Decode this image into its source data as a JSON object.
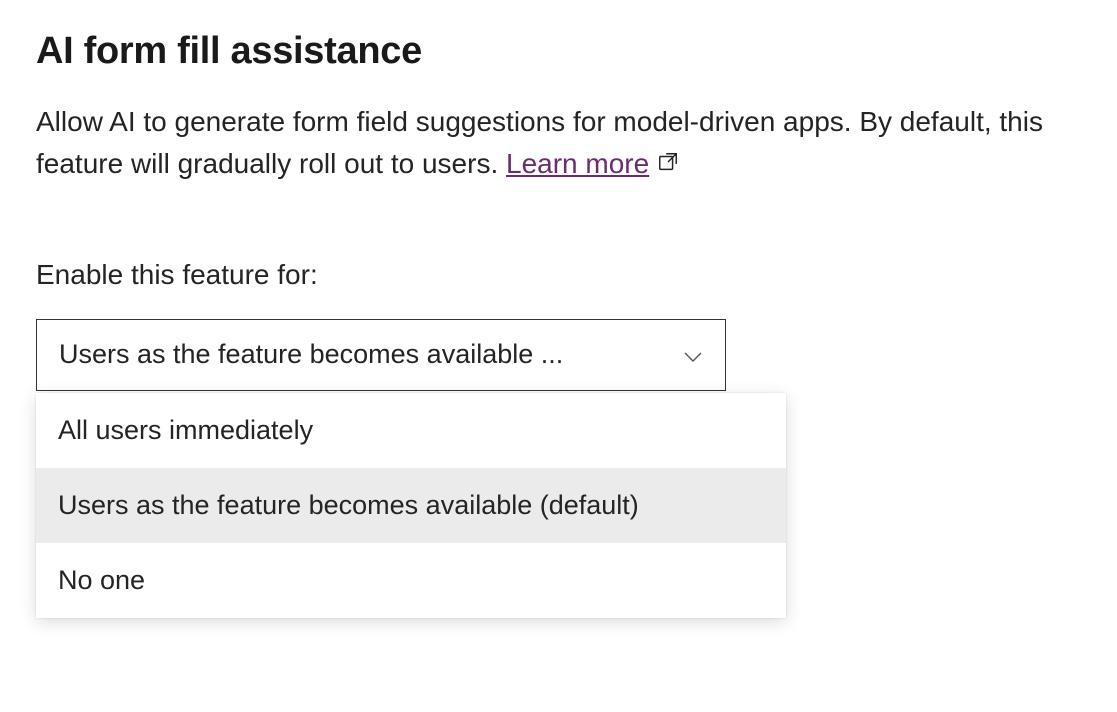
{
  "heading": "AI form fill assistance",
  "description_part1": "Allow AI to generate form field suggestions for model-driven apps. By default, this feature will gradually roll out to users. ",
  "learn_more": "Learn more",
  "label": "Enable this feature for:",
  "select": {
    "displayed": "Users as the feature becomes available ...",
    "options": [
      {
        "label": "All users immediately",
        "selected": false
      },
      {
        "label": "Users as the feature becomes available (default)",
        "selected": true
      },
      {
        "label": "No one",
        "selected": false
      }
    ]
  }
}
